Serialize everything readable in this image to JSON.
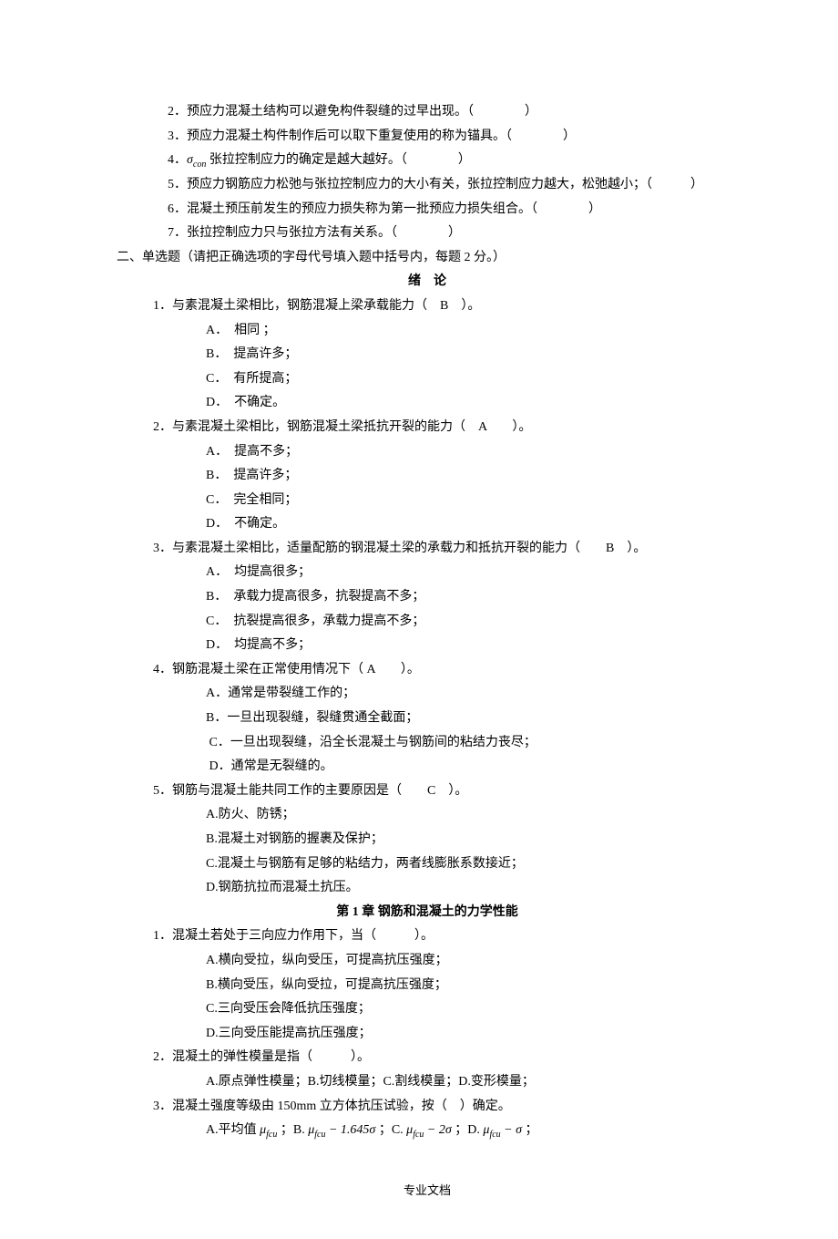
{
  "tf": {
    "q2": "2．预应力混凝土结构可以避免构件裂缝的过早出现。（　　　　）",
    "q3": "3．预应力混凝土构件制作后可以取下重复使用的称为锚具。（　　　　）",
    "q4_pre": "4．",
    "q4_post": " 张拉控制应力的确定是越大越好。（　　　　）",
    "q5": "5．预应力钢筋应力松弛与张拉控制应力的大小有关，张拉控制应力越大，松弛越小；（　　　）",
    "q6": "6．混凝土预压前发生的预应力损失称为第一批预应力损失组合。（　　　　）",
    "q7": "7．张拉控制应力只与张拉方法有关系。（　　　　）"
  },
  "mc_header": "二、单选题（请把正确选项的字母代号填入题中括号内，每题 2 分。）",
  "section_intro": "绪　论",
  "mc": {
    "q1": {
      "stem": "1．与素混凝土梁相比，钢筋混凝上梁承载能力（　B　）。",
      "a": "A．　相同 ；",
      "b": "B．　提高许多；",
      "c": "C．　有所提高；",
      "d": "D．　不确定。"
    },
    "q2": {
      "stem": "2．与素混凝土梁相比，钢筋混凝土梁抵抗开裂的能力（　A　　）。",
      "a": "A．　提高不多；",
      "b": "B．　提高许多；",
      "c": "C．　完全相同；",
      "d": "D．　不确定。"
    },
    "q3": {
      "stem": "3．与素混凝土梁相比，适量配筋的钢混凝土梁的承载力和抵抗开裂的能力（　　B　）。",
      "a": "A．　均提高很多；",
      "b": "B．　承载力提高很多，抗裂提高不多；",
      "c": "C．　抗裂提高很多，承载力提高不多；",
      "d": "D．　均提高不多；"
    },
    "q4": {
      "stem": "4．钢筋混凝土梁在正常使用情况下（ A　　）。",
      "a": "A．通常是带裂缝工作的；",
      "b": "B．一旦出现裂缝，裂缝贯通全截面；",
      "c": " C．一旦出现裂缝，沿全长混凝土与钢筋间的粘结力丧尽；",
      "d": " D．通常是无裂缝的。"
    },
    "q5": {
      "stem": "5．钢筋与混凝土能共同工作的主要原因是（　　C　）。",
      "a": "A.防火、防锈；",
      "b": "B.混凝土对钢筋的握裹及保护；",
      "c": "C.混凝土与钢筋有足够的粘结力，两者线膨胀系数接近；",
      "d": "D.钢筋抗拉而混凝土抗压。"
    }
  },
  "section_ch1": "第 1 章 钢筋和混凝土的力学性能",
  "ch1": {
    "q1": {
      "stem": "1．混凝土若处于三向应力作用下，当（　　　）。",
      "a": "A.横向受拉，纵向受压，可提高抗压强度；",
      "b": "B.横向受压，纵向受拉，可提高抗压强度；",
      "c": "C.三向受压会降低抗压强度；",
      "d": "D.三向受压能提高抗压强度；"
    },
    "q2": {
      "stem": "2．混凝土的弹性模量是指（　　　）。",
      "opts": "A.原点弹性模量；B.切线模量；C.割线模量；D.变形模量；"
    },
    "q3": {
      "stem": "3．混凝土强度等级由 150mm 立方体抗压试验，按（　）确定。",
      "a_pre": "A.平均值",
      "b_pre": "；B. ",
      "c_pre": " ；C. ",
      "d_pre": " ；D. ",
      "end": "；"
    }
  },
  "footer": "专业文档"
}
